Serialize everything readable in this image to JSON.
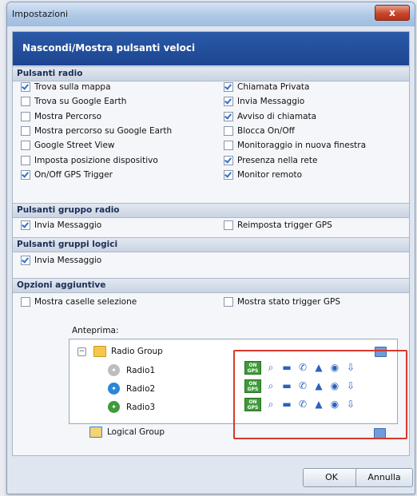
{
  "window": {
    "title": "Impostazioni",
    "close_glyph": "x"
  },
  "header": {
    "title": "Nascondi/Mostra pulsanti veloci"
  },
  "sections": {
    "radio": {
      "title": "Pulsanti radio",
      "left": [
        {
          "label": "Trova sulla mappa",
          "checked": true
        },
        {
          "label": "Trova su Google Earth",
          "checked": false
        },
        {
          "label": "Mostra Percorso",
          "checked": false
        },
        {
          "label": "Mostra percorso su Google Earth",
          "checked": false
        },
        {
          "label": "Google Street View",
          "checked": false
        },
        {
          "label": "Imposta posizione dispositivo",
          "checked": false
        },
        {
          "label": "On/Off GPS Trigger",
          "checked": true
        }
      ],
      "right": [
        {
          "label": "Chiamata Privata",
          "checked": true
        },
        {
          "label": "Invia Messaggio",
          "checked": true
        },
        {
          "label": "Avviso di chiamata",
          "checked": true
        },
        {
          "label": "Blocca On/Off",
          "checked": false
        },
        {
          "label": "Monitoraggio in nuova finestra",
          "checked": false
        },
        {
          "label": "Presenza nella rete",
          "checked": true
        },
        {
          "label": "Monitor remoto",
          "checked": true
        }
      ]
    },
    "group_radio": {
      "title": "Pulsanti gruppo radio",
      "left": [
        {
          "label": "Invia Messaggio",
          "checked": true
        }
      ],
      "right": [
        {
          "label": "Reimposta trigger GPS",
          "checked": false
        }
      ]
    },
    "logic_groups": {
      "title": "Pulsanti gruppi logici",
      "left": [
        {
          "label": "Invia Messaggio",
          "checked": true
        }
      ]
    },
    "additional": {
      "title": "Opzioni aggiuntive",
      "left": [
        {
          "label": "Mostra caselle selezione",
          "checked": false
        }
      ],
      "right": [
        {
          "label": "Mostra stato trigger GPS",
          "checked": false
        }
      ]
    }
  },
  "preview": {
    "label": "Anteprima:",
    "tree": {
      "group": "Radio Group",
      "radios": [
        "Radio1",
        "Radio2",
        "Radio3"
      ],
      "logical_group": "Logical Group"
    },
    "quick_buttons": [
      "gps-trigger-icon",
      "search-icon",
      "message-icon",
      "call-icon",
      "alert-icon",
      "presence-icon",
      "monitor-icon"
    ],
    "gps_badge_top": "ON",
    "gps_badge_bottom": "GPS",
    "highlight_color": "#d7382e"
  },
  "footer": {
    "ok": "OK",
    "cancel": "Annulla"
  },
  "colors": {
    "header": "#1d4591",
    "check": "#2f6fcf",
    "gps": "#3f9b3a"
  }
}
